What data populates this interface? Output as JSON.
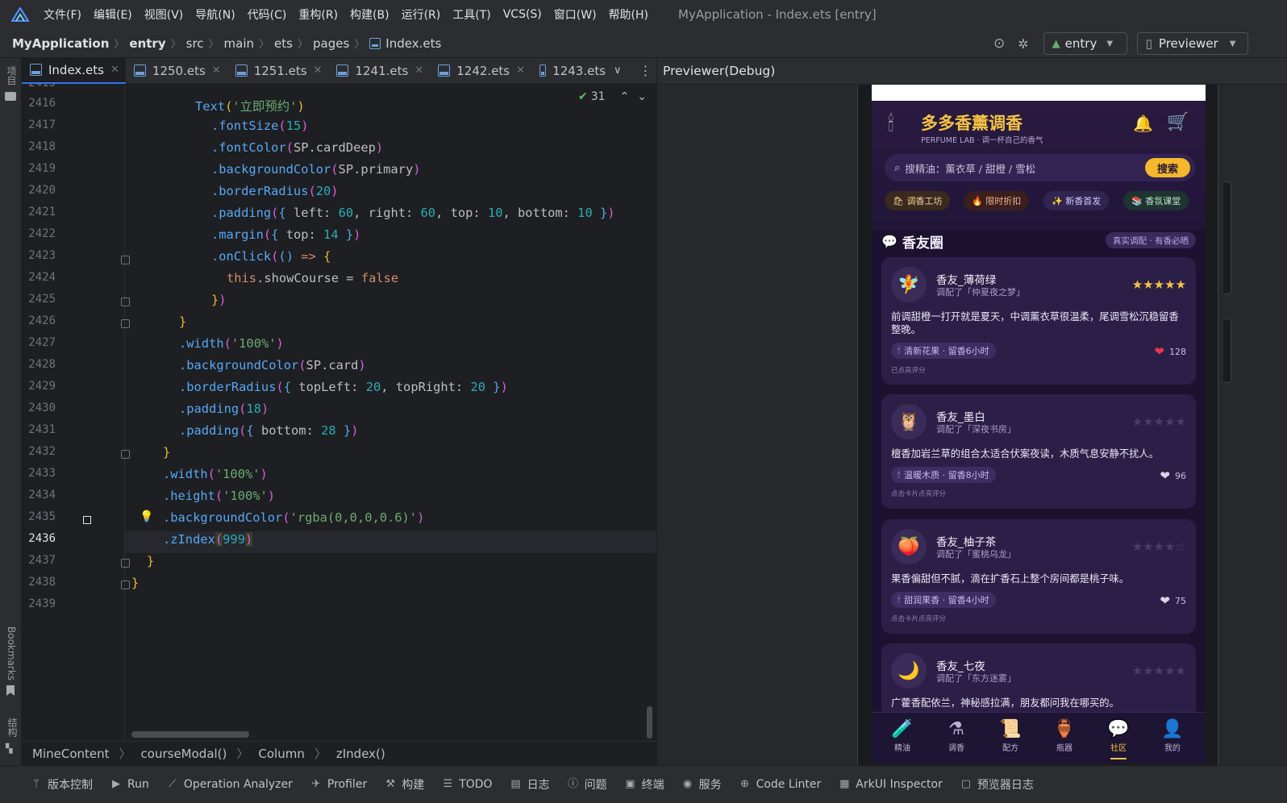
{
  "window": {
    "title": "MyApplication - Index.ets [entry]",
    "menu": [
      "文件(F)",
      "编辑(E)",
      "视图(V)",
      "导航(N)",
      "代码(C)",
      "重构(R)",
      "构建(B)",
      "运行(R)",
      "工具(T)",
      "VCS(S)",
      "窗口(W)",
      "帮助(H)"
    ]
  },
  "breadcrumb": [
    "MyApplication",
    "entry",
    "src",
    "main",
    "ets",
    "pages",
    "Index.ets"
  ],
  "toolbar": {
    "module": "entry",
    "previewer": "Previewer"
  },
  "leftstrip": {
    "project": "项目",
    "bookmarks": "Bookmarks",
    "structure": "结构"
  },
  "tabs": [
    {
      "label": "Index.ets",
      "active": true
    },
    {
      "label": "1250.ets"
    },
    {
      "label": "1251.ets"
    },
    {
      "label": "1241.ets"
    },
    {
      "label": "1242.ets"
    },
    {
      "label": "1243.ets"
    }
  ],
  "editor": {
    "inspection_count": "31",
    "first_line": 2415,
    "current_line": 2436,
    "line_numbers": [
      "2415",
      "2416",
      "2417",
      "2418",
      "2419",
      "2420",
      "2421",
      "2422",
      "2423",
      "2424",
      "2425",
      "2426",
      "2427",
      "2428",
      "2429",
      "2430",
      "2431",
      "2432",
      "2433",
      "2434",
      "2435",
      "2436",
      "2437",
      "2438",
      "2439"
    ]
  },
  "code_breadcrumb": [
    "MineContent",
    "courseModal()",
    "Column",
    "zIndex()"
  ],
  "statusbar": [
    "版本控制",
    "Run",
    "Operation Analyzer",
    "Profiler",
    "构建",
    "TODO",
    "日志",
    "问题",
    "终端",
    "服务",
    "Code Linter",
    "ArkUI Inspector",
    "预览器日志"
  ],
  "previewer": {
    "title": "Previewer(Debug)",
    "app": {
      "name": "多多香薰调香",
      "subtitle": "PERFUME LAB · 调一杯自己的香气",
      "search_placeholder": "搜精油：薰衣草 / 甜橙 / 雪松",
      "search_button": "搜索",
      "chips": [
        "🛍 调香工坊",
        "🔥 限时折扣",
        "✨ 新香首发",
        "📚 香氛课堂"
      ],
      "feed_title": "香友圈",
      "feed_tag": "真实调配 · 有香必晒",
      "posts": [
        {
          "avatar": "🧚",
          "name": "香友_薄荷绿",
          "mix": "调配了「仲夏夜之梦」",
          "stars": 5,
          "filled": 5,
          "text": "前调甜橙一打开就是夏天，中调薰衣草很温柔，尾调雪松沉稳留香整晚。",
          "note": "清新花果 · 留香6小时",
          "likes": "128",
          "liked": true,
          "hint": "已点亮评分"
        },
        {
          "avatar": "🦉",
          "name": "香友_墨白",
          "mix": "调配了「深夜书房」",
          "stars": 5,
          "filled": 0,
          "text": "檀香加岩兰草的组合太适合伏案夜读，木质气息安静不扰人。",
          "note": "温暖木质 · 留香8小时",
          "likes": "96",
          "liked": false,
          "hint": "点击卡片点亮评分"
        },
        {
          "avatar": "🍑",
          "name": "香友_柚子茶",
          "mix": "调配了「蜜桃乌龙」",
          "stars": 5,
          "filled": 0,
          "text": "果香偏甜但不腻，滴在扩香石上整个房间都是桃子味。",
          "note": "甜润果香 · 留香4小时",
          "likes": "75",
          "liked": false,
          "hint": "点击卡片点亮评分"
        },
        {
          "avatar": "🌙",
          "name": "香友_七夜",
          "mix": "调配了「东方迷雾」",
          "stars": 5,
          "filled": 0,
          "text": "广藿香配依兰，神秘感拉满，朋友都问我在哪买的。"
        }
      ],
      "tabbar": [
        {
          "icon": "🧪",
          "label": "精油"
        },
        {
          "icon": "⚗",
          "label": "调香"
        },
        {
          "icon": "📜",
          "label": "配方"
        },
        {
          "icon": "🏺",
          "label": "瓶器"
        },
        {
          "icon": "💬",
          "label": "社区",
          "active": true
        },
        {
          "icon": "👤",
          "label": "我的"
        }
      ]
    }
  },
  "colors": {
    "accent": "#f5c343",
    "editor_bg": "#1e1f22",
    "ide_bg": "#2b2d30",
    "app_bg": "#1c1230",
    "card": "#2c1f47"
  }
}
